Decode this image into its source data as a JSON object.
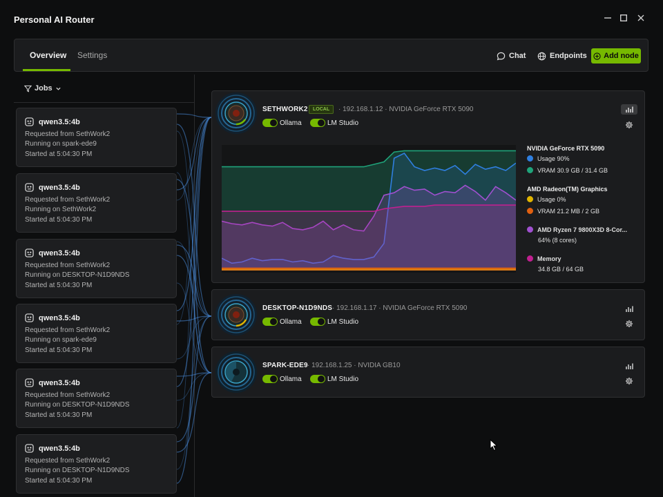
{
  "app": {
    "title": "Personal AI Router"
  },
  "window_controls": {
    "minimize": "—",
    "maximize": "☐",
    "close": "✕"
  },
  "tabs": [
    {
      "label": "Overview",
      "active": true
    },
    {
      "label": "Settings",
      "active": false
    }
  ],
  "actions": {
    "chat": "Chat",
    "endpoints": "Endpoints",
    "add_node": "Add node"
  },
  "colors": {
    "accent": "#76b900",
    "usage": "#2f7fe0",
    "vram": "#1fa37a",
    "amd_usage": "#e0b400",
    "amd_vram": "#e06010",
    "cpu": "#a050d0",
    "memory": "#c02090"
  },
  "jobs": {
    "filter_label": "Jobs",
    "items": [
      {
        "model": "qwen3.5:4b",
        "requested": "Requested from SethWork2",
        "running": "Running on spark-ede9",
        "started": "Started at 5:04:30 PM"
      },
      {
        "model": "qwen3.5:4b",
        "requested": "Requested from SethWork2",
        "running": "Running on SethWork2",
        "started": "Started at 5:04:30 PM"
      },
      {
        "model": "qwen3.5:4b",
        "requested": "Requested from SethWork2",
        "running": "Running on DESKTOP-N1D9NDS",
        "started": "Started at 5:04:30 PM"
      },
      {
        "model": "qwen3.5:4b",
        "requested": "Requested from SethWork2",
        "running": "Running on spark-ede9",
        "started": "Started at 5:04:30 PM"
      },
      {
        "model": "qwen3.5:4b",
        "requested": "Requested from SethWork2",
        "running": "Running on DESKTOP-N1D9NDS",
        "started": "Started at 5:04:30 PM"
      },
      {
        "model": "qwen3.5:4b",
        "requested": "Requested from SethWork2",
        "running": "Running on DESKTOP-N1D9NDS",
        "started": "Started at 5:04:30 PM"
      }
    ]
  },
  "nodes": [
    {
      "name": "SETHWORK2",
      "badge": "LOCAL",
      "meta": "· 192.168.1.12  · NVIDIA GeForce RTX 5090",
      "toggles": [
        "Ollama",
        "LM Studio"
      ],
      "legend": {
        "gpu1_name": "NVIDIA GeForce RTX 5090",
        "gpu1_usage": "Usage  90%",
        "gpu1_vram": "VRAM  30.9 GB / 31.4 GB",
        "gpu2_name": "AMD Radeon(TM) Graphics",
        "gpu2_usage": "Usage  0%",
        "gpu2_vram": "VRAM  21.2 MB / 2 GB",
        "cpu_name": "AMD Ryzen 7 9800X3D 8-Cor...",
        "cpu_value": "64% (8 cores)",
        "mem_name": "Memory",
        "mem_value": "34.8 GB / 64 GB"
      }
    },
    {
      "name": "DESKTOP-N1D9NDS",
      "meta": "· 192.168.1.17  · NVIDIA GeForce RTX 5090",
      "toggles": [
        "Ollama",
        "LM Studio"
      ]
    },
    {
      "name": "SPARK-EDE9",
      "meta": "· 192.168.1.25  · NVIDIA GB10",
      "toggles": [
        "Ollama",
        "LM Studio"
      ]
    }
  ],
  "chart_data": {
    "type": "area",
    "x": [
      0,
      1,
      2,
      3,
      4,
      5,
      6,
      7,
      8,
      9,
      10,
      11,
      12,
      13,
      14,
      15,
      16,
      17,
      18,
      19,
      20,
      21,
      22,
      23,
      24,
      25,
      26,
      27,
      28,
      29
    ],
    "ylim": [
      0,
      100
    ],
    "grid": false,
    "series": [
      {
        "name": "VRAM",
        "values": [
          84,
          84,
          84,
          84,
          84,
          84,
          84,
          84,
          84,
          84,
          84,
          84,
          84,
          84,
          84,
          86,
          88,
          96,
          97,
          97,
          97,
          97,
          97,
          97,
          97,
          97,
          97,
          97,
          97,
          97
        ]
      },
      {
        "name": "Usage",
        "values": [
          10,
          6,
          7,
          10,
          8,
          9,
          9,
          7,
          8,
          6,
          7,
          12,
          10,
          9,
          9,
          11,
          22,
          91,
          95,
          84,
          81,
          83,
          81,
          85,
          78,
          86,
          82,
          84,
          81,
          87
        ]
      },
      {
        "name": "AMD Ryzen 7 9800X3D 8-Cor...",
        "values": [
          40,
          38,
          37,
          39,
          37,
          36,
          39,
          34,
          33,
          35,
          40,
          33,
          37,
          33,
          32,
          44,
          61,
          63,
          68,
          65,
          66,
          61,
          64,
          63,
          69,
          64,
          57,
          68,
          63,
          57
        ]
      },
      {
        "name": "Memory",
        "values": [
          48,
          48,
          48,
          48,
          48,
          48,
          48,
          48,
          48,
          48,
          48,
          48,
          48,
          48,
          48,
          48,
          50,
          51,
          52,
          52,
          52,
          53,
          53,
          53,
          53,
          53,
          53,
          53,
          53,
          53
        ]
      },
      {
        "name": "Usage",
        "values": [
          1,
          1,
          1,
          1,
          1,
          1,
          1,
          1,
          1,
          1,
          1,
          1,
          1,
          1,
          1,
          1,
          1,
          1,
          1,
          1,
          1,
          1,
          1,
          1,
          1,
          1,
          1,
          1,
          1,
          1
        ]
      },
      {
        "name": "VRAM",
        "values": [
          2,
          2,
          2,
          2,
          2,
          2,
          2,
          2,
          2,
          2,
          2,
          2,
          2,
          2,
          2,
          2,
          2,
          2,
          2,
          2,
          2,
          2,
          2,
          2,
          2,
          2,
          2,
          2,
          2,
          2
        ]
      }
    ]
  }
}
